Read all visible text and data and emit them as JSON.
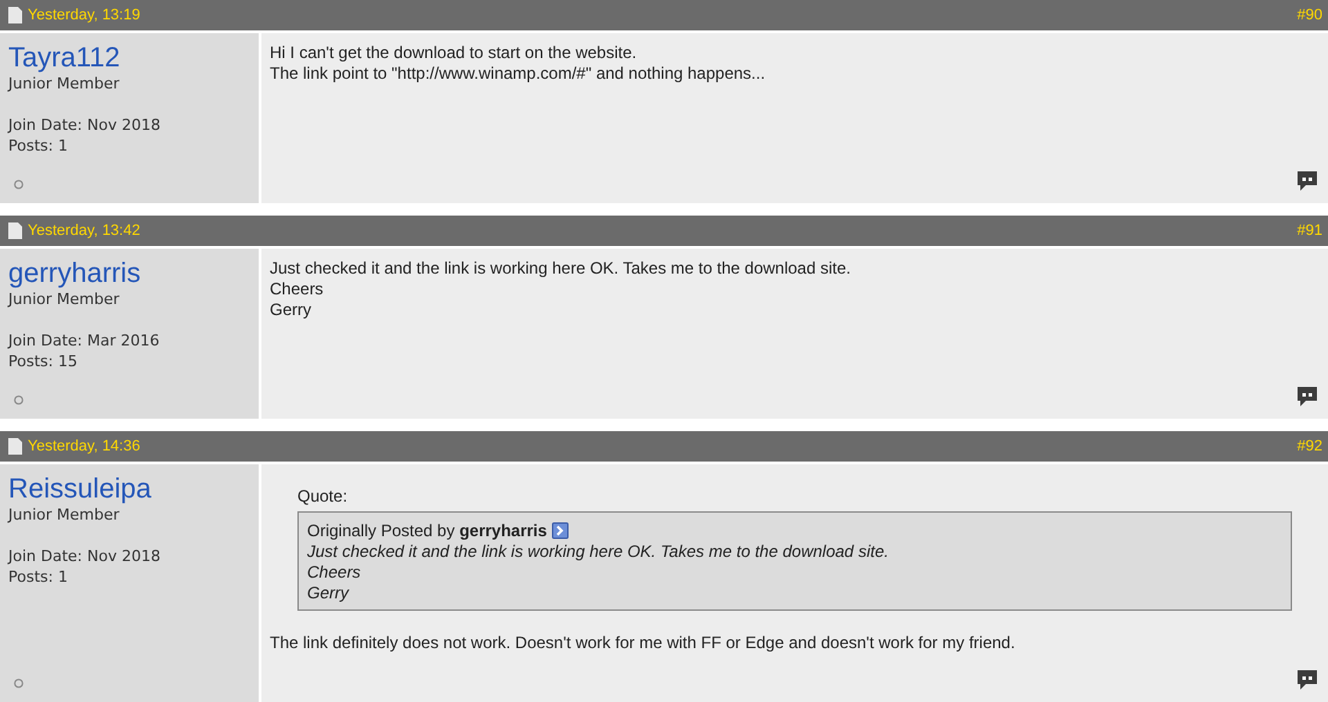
{
  "posts": [
    {
      "date": "Yesterday, 13:19",
      "number": "#90",
      "username": "Tayra112",
      "rank": "Junior Member",
      "join_date": "Join Date: Nov 2018",
      "post_count": "Posts: 1",
      "online": false,
      "lines": [
        "Hi I can't get the download to start on the website.",
        "The link point to \"http://www.winamp.com/#\" and nothing happens..."
      ]
    },
    {
      "date": "Yesterday, 13:42",
      "number": "#91",
      "username": "gerryharris",
      "rank": "Junior Member",
      "join_date": "Join Date: Mar 2016",
      "post_count": "Posts: 15",
      "online": false,
      "lines": [
        "Just checked it and the link is working here OK. Takes me to the download site.",
        "Cheers",
        "Gerry"
      ]
    },
    {
      "date": "Yesterday, 14:36",
      "number": "#92",
      "username": "Reissuleipa",
      "rank": "Junior Member",
      "join_date": "Join Date: Nov 2018",
      "post_count": "Posts: 1",
      "online": false,
      "quote": {
        "label": "Quote:",
        "attribution": "Originally Posted by **gerryharris**",
        "lines": [
          "Just checked it and the link is working here OK. Takes me to the download site.",
          "Cheers",
          "Gerry"
        ]
      },
      "lines": [
        "The link definitely does not work. Doesn't work for me with FF or Edge and doesn't work for my friend."
      ]
    }
  ]
}
